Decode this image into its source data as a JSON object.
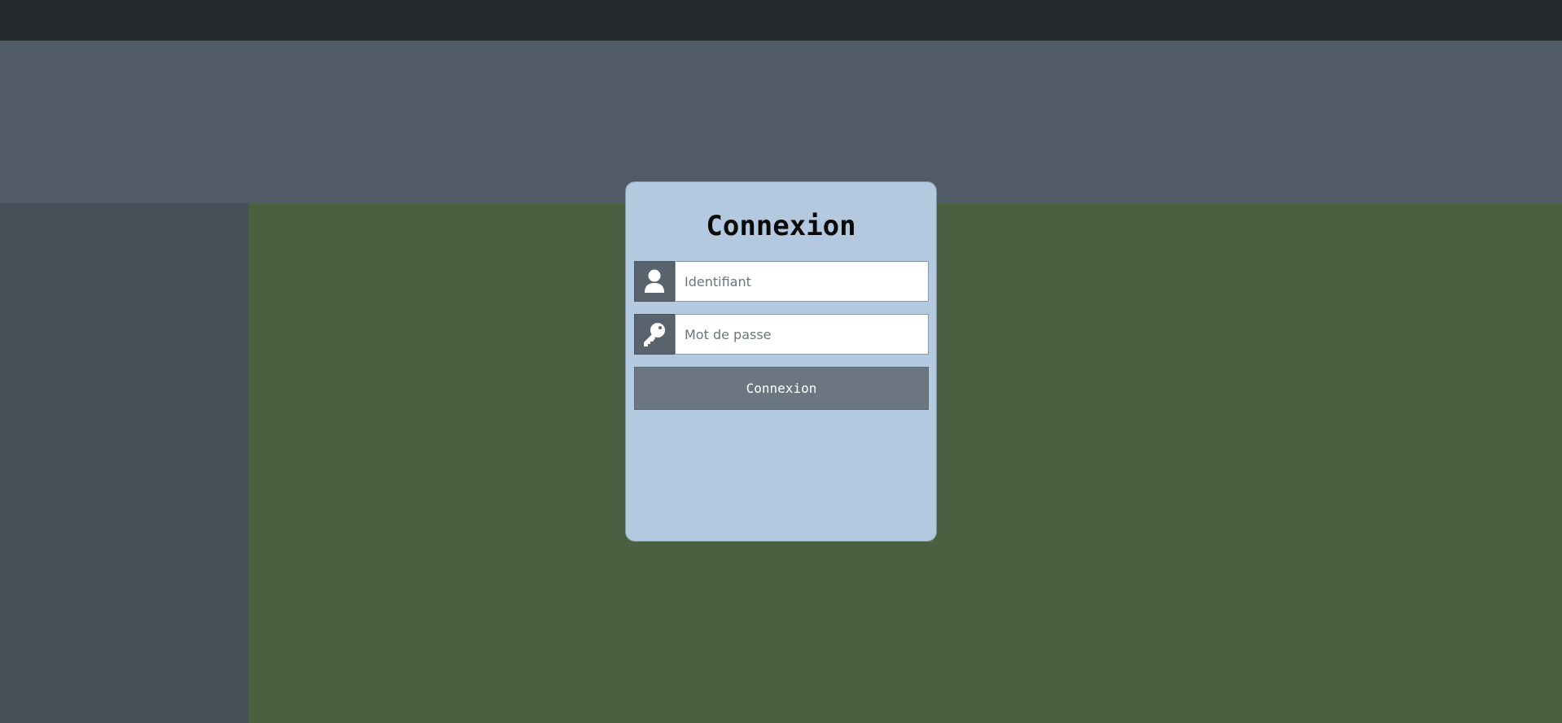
{
  "login": {
    "title": "Connexion",
    "username": {
      "placeholder": "Identifiant",
      "value": "",
      "icon": "user-icon"
    },
    "password": {
      "placeholder": "Mot de passe",
      "value": "",
      "icon": "key-icon"
    },
    "submit_label": "Connexion"
  },
  "colors": {
    "topbar": "#24292e",
    "header_band": "#515b65",
    "sidebar": "#474f59",
    "main": "#4a6141",
    "card": "#b2c9df",
    "icon_box": "#58636e",
    "button": "#6c7680"
  }
}
